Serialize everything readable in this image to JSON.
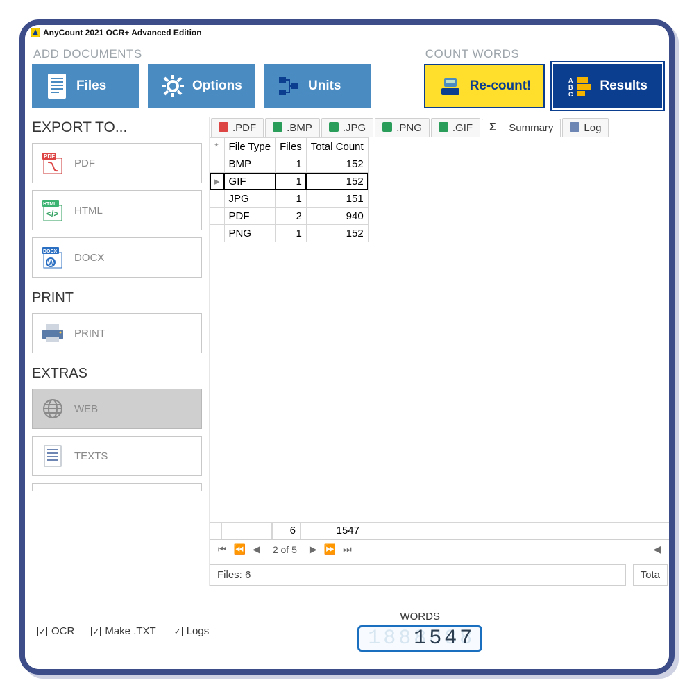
{
  "window": {
    "title": "AnyCount 2021 OCR+   Advanced Edition"
  },
  "sections": {
    "add_documents": "ADD DOCUMENTS",
    "count_words": "COUNT WORDS"
  },
  "ribbon": {
    "files": "Files",
    "options": "Options",
    "units": "Units",
    "recount": "Re-count!",
    "results": "Results"
  },
  "sidebar": {
    "export_header": "EXPORT TO...",
    "items": [
      {
        "label": "PDF",
        "icon": "pdf"
      },
      {
        "label": "HTML",
        "icon": "html"
      },
      {
        "label": "DOCX",
        "icon": "docx"
      }
    ],
    "print_header": "PRINT",
    "print_label": "PRINT",
    "extras_header": "EXTRAS",
    "extras": [
      {
        "label": "WEB",
        "icon": "web",
        "active": true
      },
      {
        "label": "TEXTS",
        "icon": "texts"
      }
    ]
  },
  "tabs": [
    {
      "label": ".PDF",
      "icon": "pdf"
    },
    {
      "label": ".BMP",
      "icon": "img"
    },
    {
      "label": ".JPG",
      "icon": "img"
    },
    {
      "label": ".PNG",
      "icon": "img"
    },
    {
      "label": ".GIF",
      "icon": "img"
    },
    {
      "label": "Summary",
      "icon": "sigma",
      "active": true
    },
    {
      "label": "Log",
      "icon": "log"
    }
  ],
  "grid": {
    "columns": [
      "File Type",
      "Files",
      "Total Count"
    ],
    "rows": [
      {
        "type": "BMP",
        "files": 1,
        "count": 152
      },
      {
        "type": "GIF",
        "files": 1,
        "count": 152,
        "selected": true
      },
      {
        "type": "JPG",
        "files": 1,
        "count": 151
      },
      {
        "type": "PDF",
        "files": 2,
        "count": 940
      },
      {
        "type": "PNG",
        "files": 1,
        "count": 152
      }
    ],
    "totals": {
      "files": 6,
      "count": 1547
    }
  },
  "pager": {
    "text": "2 of 5"
  },
  "status": {
    "files_label": "Files: 6",
    "right_truncated": "Tota"
  },
  "bottom": {
    "ocr": "OCR",
    "make_txt": "Make .TXT",
    "logs": "Logs",
    "lcd_label": "WORDS",
    "lcd_value": "1547",
    "lcd_ghost": "1888888"
  }
}
